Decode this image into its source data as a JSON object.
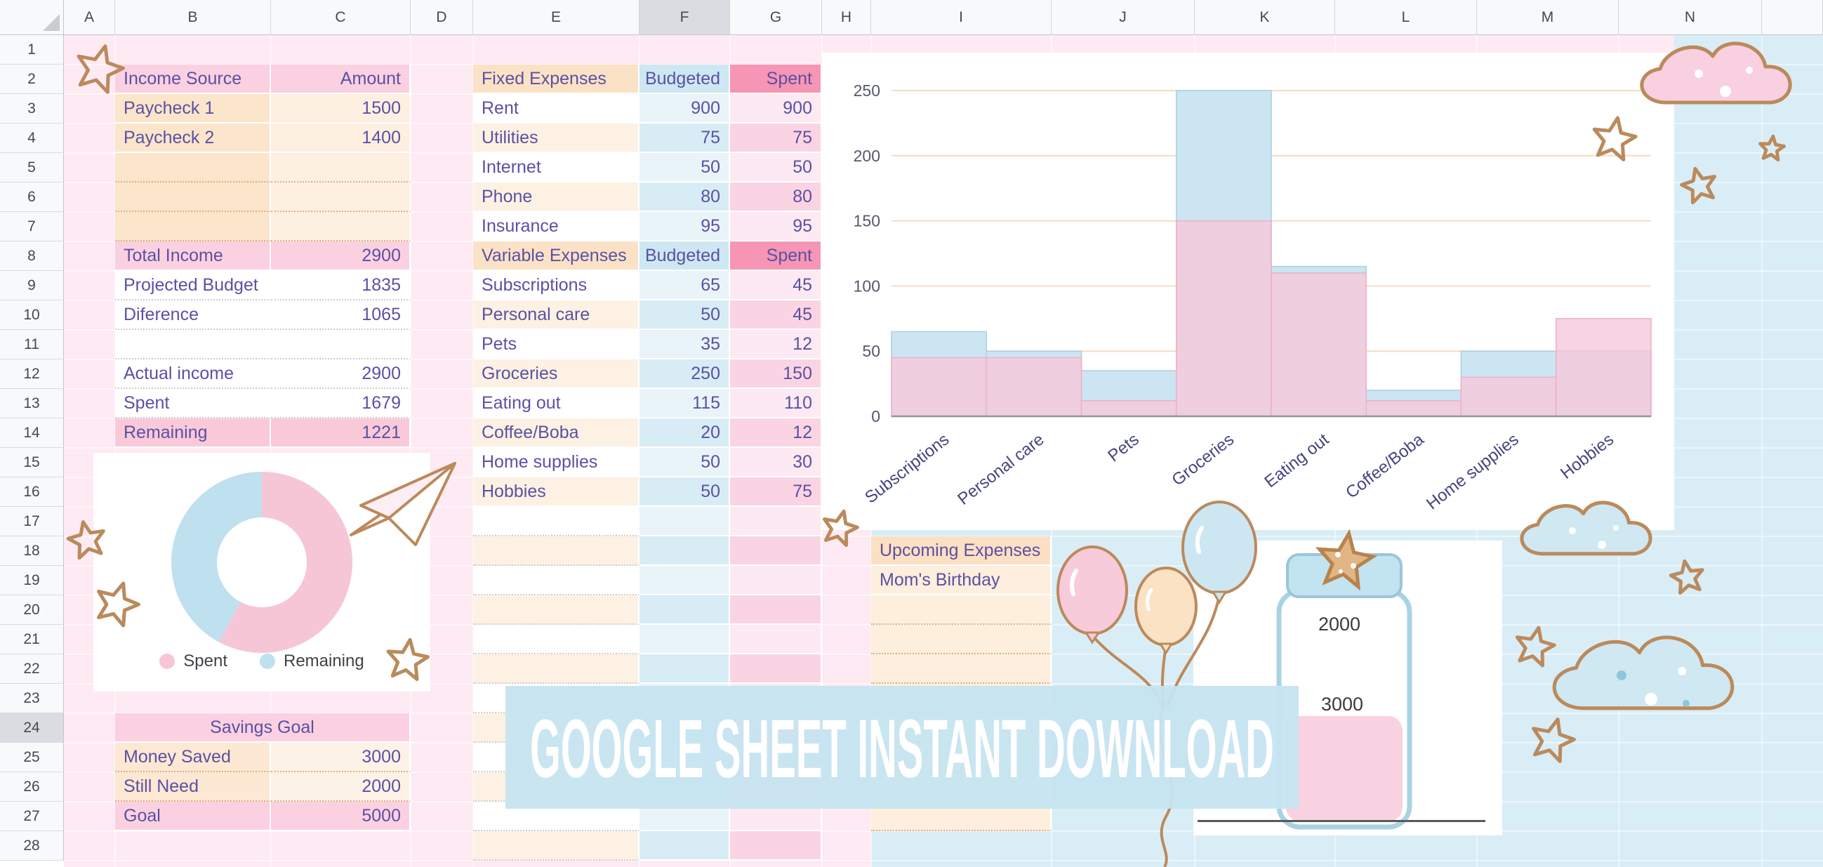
{
  "grid": {
    "columns": [
      "A",
      "B",
      "C",
      "D",
      "E",
      "F",
      "G",
      "H",
      "I",
      "J",
      "K",
      "L",
      "M",
      "N"
    ],
    "highlighted_column": "F",
    "row_count": 28,
    "highlighted_row": 24
  },
  "income_table": {
    "header_label": "Income Source",
    "header_amount": "Amount",
    "rows": [
      {
        "label": "Paycheck 1",
        "value": "1500",
        "style": "peach"
      },
      {
        "label": "Paycheck 2",
        "value": "1400",
        "style": "peach"
      },
      {
        "label": "",
        "value": "",
        "style": "peach"
      },
      {
        "label": "",
        "value": "",
        "style": "peach"
      },
      {
        "label": "",
        "value": "",
        "style": "peach"
      },
      {
        "label": "Total Income",
        "value": "2900",
        "style": "pink"
      },
      {
        "label": "Projected Budget",
        "value": "1835",
        "style": "white"
      },
      {
        "label": "Diference",
        "value": "1065",
        "style": "white"
      },
      {
        "label": "",
        "value": "",
        "style": "white"
      },
      {
        "label": "Actual income",
        "value": "2900",
        "style": "white"
      },
      {
        "label": "Spent",
        "value": "1679",
        "style": "white"
      },
      {
        "label": "Remaining",
        "value": "1221",
        "style": "pink2"
      }
    ]
  },
  "expenses_table": {
    "sections": [
      {
        "header": {
          "name": "Fixed Expenses",
          "budgeted": "Budgeted",
          "spent": "Spent"
        },
        "rows": [
          {
            "name": "Rent",
            "budgeted": "900",
            "spent": "900"
          },
          {
            "name": "Utilities",
            "budgeted": "75",
            "spent": "75"
          },
          {
            "name": "Internet",
            "budgeted": "50",
            "spent": "50"
          },
          {
            "name": "Phone",
            "budgeted": "80",
            "spent": "80"
          },
          {
            "name": "Insurance",
            "budgeted": "95",
            "spent": "95"
          }
        ]
      },
      {
        "header": {
          "name": "Variable Expenses",
          "budgeted": "Budgeted",
          "spent": "Spent"
        },
        "rows": [
          {
            "name": "Subscriptions",
            "budgeted": "65",
            "spent": "45"
          },
          {
            "name": "Personal care",
            "budgeted": "50",
            "spent": "45"
          },
          {
            "name": "Pets",
            "budgeted": "35",
            "spent": "12"
          },
          {
            "name": "Groceries",
            "budgeted": "250",
            "spent": "150"
          },
          {
            "name": "Eating out",
            "budgeted": "115",
            "spent": "110"
          },
          {
            "name": "Coffee/Boba",
            "budgeted": "20",
            "spent": "12"
          },
          {
            "name": "Home supplies",
            "budgeted": "50",
            "spent": "30"
          },
          {
            "name": "Hobbies",
            "budgeted": "50",
            "spent": "75"
          }
        ]
      }
    ],
    "empty_row_count": 12
  },
  "savings_table": {
    "title": "Savings Goal",
    "rows": [
      {
        "label": "Money Saved",
        "value": "3000"
      },
      {
        "label": "Still Need",
        "value": "2000"
      },
      {
        "label": "Goal",
        "value": "5000"
      }
    ]
  },
  "upcoming": {
    "title": "Upcoming Expenses",
    "rows": [
      "Mom's Birthday",
      "",
      "",
      "",
      "",
      "",
      "",
      "",
      ""
    ]
  },
  "banner": {
    "text": "GOOGLE SHEET INSTANT DOWNLOAD"
  },
  "jar": {
    "top_label": "2000",
    "bottom_label": "3000"
  },
  "decorative_icons": [
    "star-icon",
    "cloud-icon",
    "balloon-icon",
    "paper-airplane-icon",
    "savings-jar-illustration",
    "cookie-star-icon"
  ],
  "colors": {
    "base_pink": "#fdeaf2",
    "light_blue_region": "#d9edf6",
    "accent_pink_header": "#fbd0e1",
    "accent_spent_header": "#f795b5",
    "accent_peach": "#fbe2c6",
    "accent_blue": "#cde8f2",
    "text_purple": "#5b51a3",
    "doodle_tan": "#bb8a5c"
  },
  "chart_data": [
    {
      "type": "area",
      "title": "",
      "categories": [
        "Subscriptions",
        "Personal care",
        "Pets",
        "Groceries",
        "Eating out",
        "Coffee/Boba",
        "Home supplies",
        "Hobbies"
      ],
      "series": [
        {
          "name": "Budgeted",
          "color": "#c9e4f1",
          "values": [
            65,
            50,
            35,
            250,
            115,
            20,
            50,
            50
          ]
        },
        {
          "name": "Spent",
          "color": "#f6c8d9",
          "values": [
            45,
            45,
            12,
            150,
            110,
            12,
            30,
            75
          ]
        }
      ],
      "xlabel": "",
      "ylabel": "",
      "ylim": [
        0,
        250
      ],
      "yticks": [
        0,
        50,
        100,
        150,
        200,
        250
      ],
      "grid": true,
      "legend": "none"
    },
    {
      "type": "pie",
      "donut": true,
      "slices": [
        {
          "label": "Spent",
          "value": 1679,
          "color": "#f6c6d7"
        },
        {
          "label": "Remaining",
          "value": 1221,
          "color": "#bfe0ee"
        }
      ],
      "legend_position": "bottom"
    }
  ]
}
